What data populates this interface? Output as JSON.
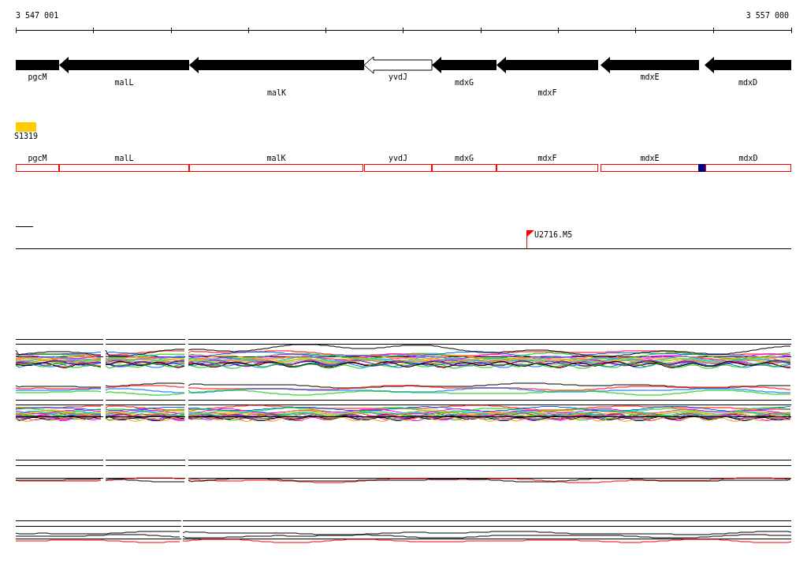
{
  "ruler": {
    "start_label": "3 547 001",
    "end_label": "3 557 000"
  },
  "genes": [
    {
      "name": "pgcM",
      "outlined": false
    },
    {
      "name": "malL",
      "outlined": false
    },
    {
      "name": "malK",
      "outlined": false
    },
    {
      "name": "yvdJ",
      "outlined": true
    },
    {
      "name": "mdxG",
      "outlined": false
    },
    {
      "name": "mdxF",
      "outlined": false
    },
    {
      "name": "mdxE",
      "outlined": false
    },
    {
      "name": "mdxD",
      "outlined": false
    }
  ],
  "feature": {
    "label": "S1319",
    "color": "#ffcc00"
  },
  "transcripts": [
    {
      "name": "pgcM"
    },
    {
      "name": "malL"
    },
    {
      "name": "malK"
    },
    {
      "name": "yvdJ"
    },
    {
      "name": "mdxG"
    },
    {
      "name": "mdxF"
    },
    {
      "name": "mdxE"
    },
    {
      "name": "mdxD"
    }
  ],
  "marker": {
    "label": "U2716.M5"
  }
}
